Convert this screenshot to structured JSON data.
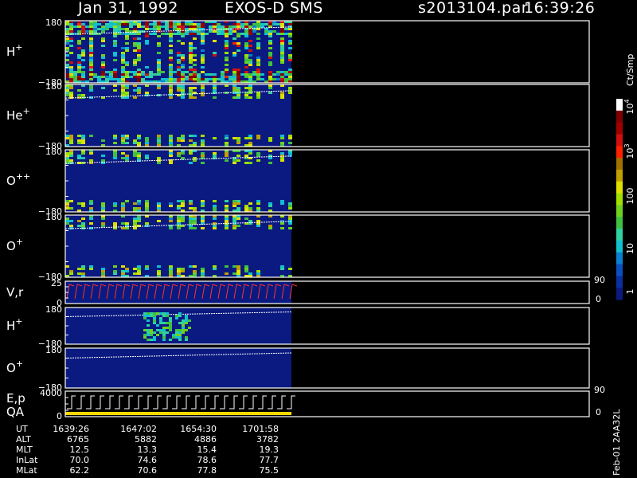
{
  "header": {
    "date": "Jan 31, 1992",
    "instrument": "EXOS-D SMS",
    "file": "s2013104.par",
    "time": "16:39:26"
  },
  "colorbar": {
    "unit": "Ct/Smp",
    "tick_labels": [
      "1",
      "10",
      "100",
      "10",
      "10"
    ],
    "tick_exponents": [
      "",
      "",
      "",
      "3",
      "4"
    ],
    "colors": [
      "#0a1a80",
      "#0a2fa0",
      "#0a4fc0",
      "#0a80d0",
      "#10c0d0",
      "#30d0a0",
      "#40c040",
      "#70d020",
      "#a0e000",
      "#e0e000",
      "#c0a000",
      "#a07000",
      "#ff2000",
      "#d01010",
      "#a00000",
      "#800000",
      "#ffffff"
    ]
  },
  "panels": [
    {
      "label": "H",
      "sup": "+",
      "ymax": "180",
      "ymin": "−180"
    },
    {
      "label": "He",
      "sup": "+",
      "ymax": "180",
      "ymin": "−180"
    },
    {
      "label": "O",
      "sup": "++",
      "ymax": "180",
      "ymin": "−180"
    },
    {
      "label": "O",
      "sup": "+",
      "ymax": "180",
      "ymin": "−180"
    },
    {
      "label": "V,r",
      "sup": "",
      "ymax": "25",
      "ymin": "0",
      "right_max": "90",
      "right_min": "0"
    },
    {
      "label": "H",
      "sup": "+",
      "ymax": "180",
      "ymin": "−180"
    },
    {
      "label": "O",
      "sup": "+",
      "ymax": "180",
      "ymin": "−180"
    },
    {
      "label": "E,p",
      "sup": "",
      "label2": "QA",
      "ymax": "4000",
      "ymin": "0",
      "right_max": "90",
      "right_min": "0"
    }
  ],
  "ephemeris": {
    "rows": [
      {
        "name": "UT",
        "values": [
          "1639:26",
          "1647:02",
          "1654:30",
          "1701:58"
        ]
      },
      {
        "name": "ALT",
        "values": [
          "6765",
          "5882",
          "4886",
          "3782"
        ]
      },
      {
        "name": "MLT",
        "values": [
          "12.5",
          "13.3",
          "15.4",
          "19.3"
        ]
      },
      {
        "name": "InLat",
        "values": [
          "70.0",
          "74.6",
          "78.6",
          "77.7"
        ]
      },
      {
        "name": "MLat",
        "values": [
          "62.2",
          "70.6",
          "77.8",
          "75.5"
        ]
      }
    ]
  },
  "footer": {
    "stamp": "Feb-01 2AA32L"
  },
  "chart_data": {
    "type": "heatmap",
    "title": "Jan 31, 1992 EXOS-D SMS",
    "x": [
      "1639:26",
      "1647:02",
      "1654:30",
      "1701:58"
    ],
    "xlabel": "UT",
    "colorbar": {
      "label": "Ct/Smp",
      "scale": "log",
      "range": [
        1,
        10000
      ]
    },
    "series": [
      {
        "name": "H+",
        "ylim": [
          -180,
          180
        ]
      },
      {
        "name": "He+",
        "ylim": [
          -180,
          180
        ]
      },
      {
        "name": "O++",
        "ylim": [
          -180,
          180
        ]
      },
      {
        "name": "O+",
        "ylim": [
          -180,
          180
        ]
      },
      {
        "name": "V,r",
        "ylim": [
          0,
          25
        ]
      },
      {
        "name": "H+",
        "ylim": [
          -180,
          180
        ]
      },
      {
        "name": "O+",
        "ylim": [
          -180,
          180
        ]
      },
      {
        "name": "E,p",
        "ylim": [
          0,
          4000
        ]
      }
    ]
  }
}
